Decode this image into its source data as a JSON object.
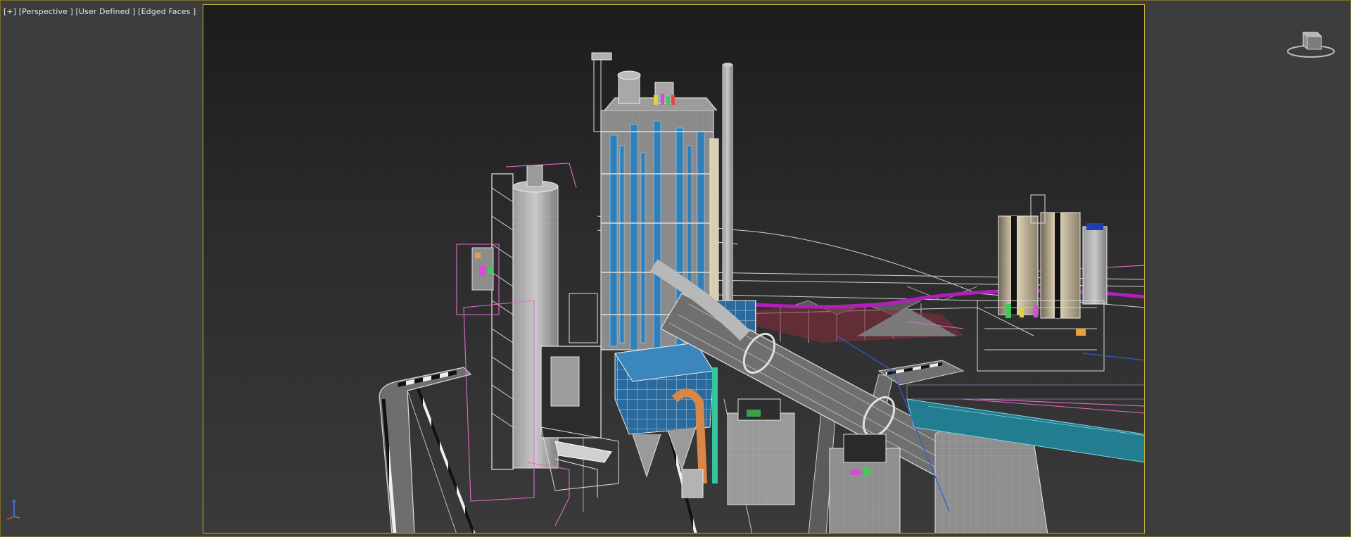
{
  "viewport": {
    "label_parts": [
      "[+]",
      "[Perspective ]",
      "[User Defined ]",
      "[Edged Faces ]"
    ],
    "view_name": "Perspective",
    "shading": "Edged Faces"
  },
  "colors": {
    "safe_frame": "#c8b43a",
    "viewport_bg": "#3d3d3d",
    "steel_blue": "#2f7fb8",
    "selection_pink": "#e06ec8",
    "wire_white": "#d8d8d8"
  },
  "icons": {
    "viewcube": "viewcube-icon",
    "tripod": "axis-tripod-icon"
  }
}
